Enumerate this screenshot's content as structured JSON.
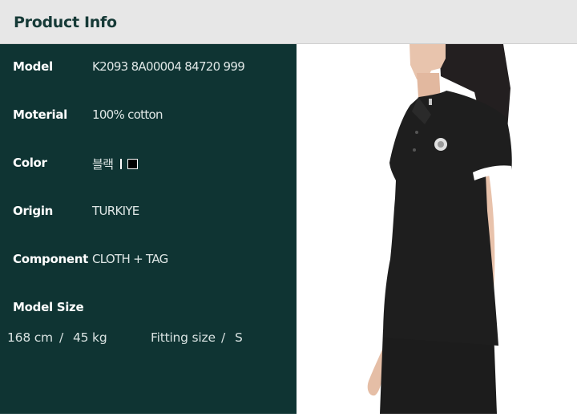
{
  "header": {
    "title": "Product Info"
  },
  "specs": [
    {
      "label": "Model",
      "value": "K2093 8A00004 84720 999"
    },
    {
      "label": "Moterial",
      "value": "100% cotton"
    },
    {
      "label": "Color",
      "value": "블랙"
    },
    {
      "label": "Origin",
      "value": "TURKIYE"
    },
    {
      "label": "Component",
      "value": "CLOTH + TAG"
    }
  ],
  "model_size": {
    "label": "Model Size",
    "height": "168 cm",
    "separator": "/",
    "weight": "45 kg",
    "fitting_label": "Fitting size",
    "fitting_value": "S"
  },
  "colors": {
    "panel_bg": "#0f3433",
    "header_bg": "#e7e7e7",
    "swatch": "#000000"
  }
}
